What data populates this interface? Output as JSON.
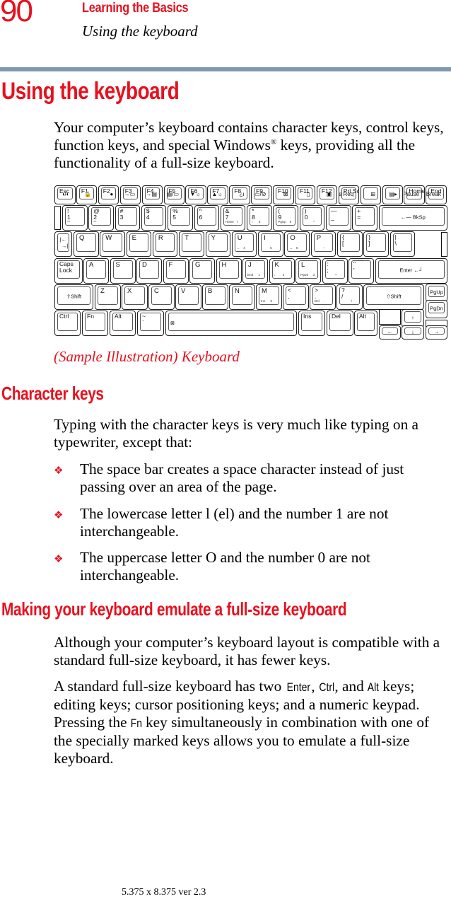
{
  "header": {
    "page_number": "90",
    "chapter": "Learning the Basics",
    "section": "Using the keyboard"
  },
  "title": "Using the keyboard",
  "intro": {
    "before_sup": "Your computer’s keyboard contains character keys, control keys, function keys, and special Windows",
    "sup": "®",
    "after_sup": " keys, providing all the functionality of a full-size keyboard."
  },
  "keyboard": {
    "function_row": [
      {
        "top": "Esc",
        "sub": "◑/◐",
        "icon": "speaker-mute-icon"
      },
      {
        "top": "F1",
        "sub": "🔒",
        "icon": "lock-icon"
      },
      {
        "top": "F2",
        "sub": "●",
        "icon": "power-icon"
      },
      {
        "top": "F3",
        "sub": "→▭",
        "icon": "standby-icon"
      },
      {
        "top": "F4",
        "sub": "→▤",
        "icon": "hibernate-icon"
      },
      {
        "top": "F5",
        "sub": "▤/▭",
        "icon": "display-switch-icon"
      },
      {
        "top": "F6",
        "sub": "▼☼",
        "icon": "brightness-down-icon"
      },
      {
        "top": "F7",
        "sub": "▲☼",
        "icon": "brightness-up-icon"
      },
      {
        "top": "F8",
        "sub": "¿ı",
        "icon": "wireless-icon"
      },
      {
        "top": "F9",
        "sub": "▭/⊘",
        "icon": "touchpad-toggle-icon"
      },
      {
        "top": "F10",
        "sub": "⊠",
        "icon": "arrow-mode-icon"
      },
      {
        "top": "F11",
        "sub": "▯",
        "icon": "numeric-mode-icon"
      },
      {
        "top": "F12",
        "sub": "▣",
        "icon": "scroll-lock-icon"
      },
      {
        "top": "Prt Sc",
        "sub": "Sys Req",
        "icon": ""
      },
      {
        "top": "",
        "sub": "⊞",
        "icon": "windows-logo-icon"
      },
      {
        "top": "",
        "sub": "▤▸",
        "icon": "application-menu-icon"
      },
      {
        "top": "Home",
        "sub": "Pause",
        "icon": ""
      },
      {
        "top": "End",
        "sub": "Break",
        "icon": ""
      }
    ],
    "number_row": [
      {
        "top": "!",
        "main": "1",
        "small": "▭"
      },
      {
        "top": "@",
        "main": "2",
        "small": "▭"
      },
      {
        "top": "#",
        "main": "3",
        "small": ""
      },
      {
        "top": "$",
        "main": "4",
        "small": ""
      },
      {
        "top": "%",
        "main": "5",
        "small": ""
      },
      {
        "top": "^",
        "main": "6",
        "small": ""
      },
      {
        "top": "&",
        "main": "7",
        "small": "Home   7"
      },
      {
        "top": "*",
        "main": "8",
        "small": "↑      8"
      },
      {
        "top": "(",
        "main": "9",
        "small": "PgUp    9"
      },
      {
        "top": ")",
        "main": "0",
        "small": "          *"
      },
      {
        "top": "—",
        "main": "_",
        "small": ""
      },
      {
        "top": "+",
        "main": "=",
        "small": ""
      }
    ],
    "backspace": "←— BkSp",
    "qwerty_row": [
      "Q",
      "W",
      "E",
      "R",
      "T",
      "Y",
      "U",
      "I",
      "O",
      "P"
    ],
    "qwerty_sub": {
      "U": "←    4",
      "I": "        5",
      "O": "→    6",
      "P": "        –"
    },
    "bracket_keys": [
      {
        "top": "{",
        "main": "["
      },
      {
        "top": "}",
        "main": "]"
      },
      {
        "top": "|",
        "main": "\\"
      }
    ],
    "tab": "|←\n  →|",
    "caps_lock": "Caps\nLock",
    "asdf_row": [
      "A",
      "S",
      "D",
      "F",
      "G",
      "H",
      "J",
      "K",
      "L"
    ],
    "asdf_sub": {
      "J": "End      1",
      "K": "↓        2",
      "L": "PgDn     3"
    },
    "punct_keys": [
      {
        "top": ":",
        "main": ";",
        "small": "         +"
      },
      {
        "top": "\"",
        "main": "'",
        "small": ""
      }
    ],
    "enter": "Enter ←┘",
    "shift": "⇧Shift",
    "zxcv_row": [
      "Z",
      "X",
      "C",
      "V",
      "B",
      "N",
      "M"
    ],
    "zxcv_sub": {
      "M": "Ins      0"
    },
    "comma_keys": [
      {
        "top": "<",
        "main": ",",
        "small": ""
      },
      {
        "top": ">",
        "main": ".",
        "small": "Del     ."
      },
      {
        "top": "?",
        "main": "/",
        "small": "           /"
      }
    ],
    "pgup": "PgUp",
    "pgdn": "PgDn",
    "bottom_row": {
      "ctrl": "Ctrl",
      "fn": "Fn",
      "alt_left": "Alt",
      "tilde_top": "~",
      "tilde_main": "`",
      "space_icon": "⊠",
      "ins": "Ins",
      "del": "Del",
      "alt_right": "Alt"
    },
    "arrows": {
      "up": "↑",
      "down": "↓",
      "left": "←",
      "right": "→"
    }
  },
  "caption": "(Sample Illustration) Keyboard",
  "character_keys": {
    "heading": "Character keys",
    "intro": "Typing with the character keys is very much like typing on a typewriter, except that:",
    "bullets": [
      "The space bar creates a space character instead of just passing over an area of the page.",
      "The lowercase letter l (el) and the number 1 are not interchangeable.",
      "The uppercase letter O and the number 0 are not interchangeable."
    ],
    "bullet_mark": "❖"
  },
  "emulate": {
    "heading": "Making your keyboard emulate a full-size keyboard",
    "para1": "Although your computer’s keyboard layout is compatible with a standard full-size keyboard, it has fewer keys.",
    "para2": {
      "part1": "A standard full-size keyboard has two ",
      "key1": "Enter",
      "part2": ", ",
      "key2": "Ctrl",
      "part3": ", and ",
      "key3": "Alt",
      "part4": " keys; editing keys; cursor positioning keys; and a numeric keypad. Pressing the ",
      "key4": "Fn",
      "part5": " key simultaneously in combination with one of the specially marked keys allows you to emulate a full-size keyboard."
    }
  },
  "footer": "5.375 x 8.375 ver 2.3",
  "colors": {
    "accent": "#e8101e",
    "rule": "#7f9ab0"
  }
}
